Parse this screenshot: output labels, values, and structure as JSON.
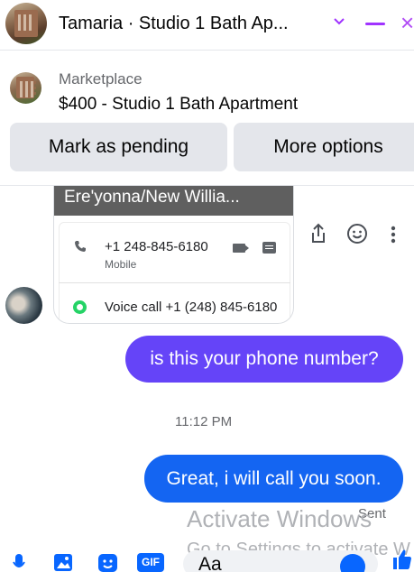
{
  "header": {
    "title": "Tamaria · Studio 1 Bath Ap...",
    "accent": "#a033ff"
  },
  "marketplace": {
    "label": "Marketplace",
    "listing_title": "$400 - Studio 1 Bath Apartment"
  },
  "actions": {
    "mark_pending": "Mark as pending",
    "more_options": "More options"
  },
  "shared_card": {
    "name": "Ere'yonna/New Willia...",
    "phone": "+1 248-845-6180",
    "phone_type": "Mobile",
    "voice_call": "Voice call +1 (248) 845-6180"
  },
  "messages": [
    {
      "text": "is this your phone number?",
      "color": "#6544f8"
    },
    {
      "text": "Great, i will call you soon.",
      "color": "#1465f2"
    }
  ],
  "timestamp": "11:12 PM",
  "status": "Sent",
  "watermark": {
    "line1": "Activate Windows",
    "line2": "Go to Settings to activate W"
  },
  "composer": {
    "placeholder": "Aa",
    "gif_label": "GIF",
    "icons": [
      "mic-icon",
      "image-icon",
      "sticker-icon",
      "gif-icon",
      "emoji-icon",
      "like-icon"
    ]
  }
}
